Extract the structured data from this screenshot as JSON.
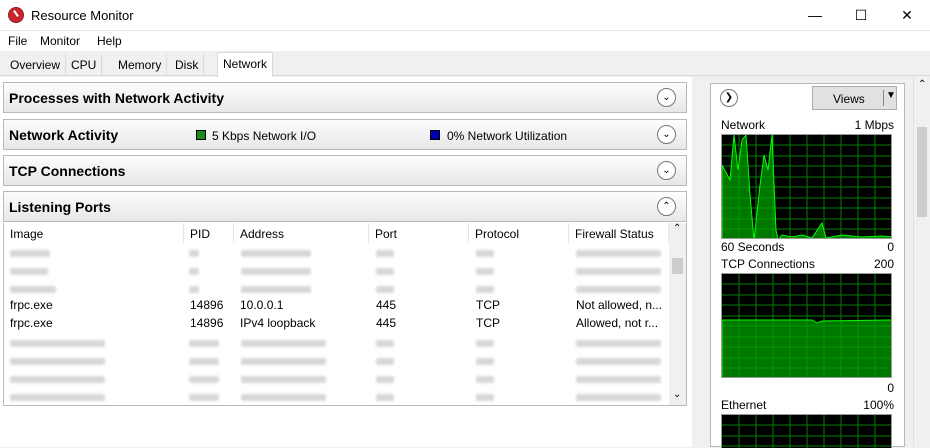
{
  "window": {
    "title": "Resource Monitor"
  },
  "menu": [
    "File",
    "Monitor",
    "Help"
  ],
  "tabs": [
    "Overview",
    "CPU",
    "Memory",
    "Disk",
    "Network"
  ],
  "sections": {
    "processes": "Processes with Network Activity",
    "network_activity": "Network Activity",
    "network_io": "5 Kbps Network I/O",
    "network_util": "0% Network Utilization",
    "tcp": "TCP Connections",
    "listening": "Listening Ports"
  },
  "columns": [
    "Image",
    "PID",
    "Address",
    "Port",
    "Protocol",
    "Firewall Status"
  ],
  "rows": [
    {
      "image": "frpc.exe",
      "pid": "14896",
      "address": "10.0.0.1",
      "port": "445",
      "protocol": "TCP",
      "firewall": "Not allowed, n..."
    },
    {
      "image": "frpc.exe",
      "pid": "14896",
      "address": "IPv4 loopback",
      "port": "445",
      "protocol": "TCP",
      "firewall": "Allowed, not r..."
    }
  ],
  "right": {
    "views_label": "Views",
    "graph1": {
      "title": "Network",
      "max": "1 Mbps",
      "footer_left": "60 Seconds",
      "footer_right": "0"
    },
    "graph2": {
      "title": "TCP Connections",
      "max": "200",
      "footer_right": "0"
    },
    "graph3": {
      "title": "Ethernet",
      "max": "100%"
    }
  },
  "colors": {
    "accent": "#0078d7",
    "graph_bg": "#000000",
    "graph_line": "#00c000",
    "grid_line": "#008000",
    "io_swatch": "#1a8c1a",
    "util_swatch": "#0000b0"
  }
}
